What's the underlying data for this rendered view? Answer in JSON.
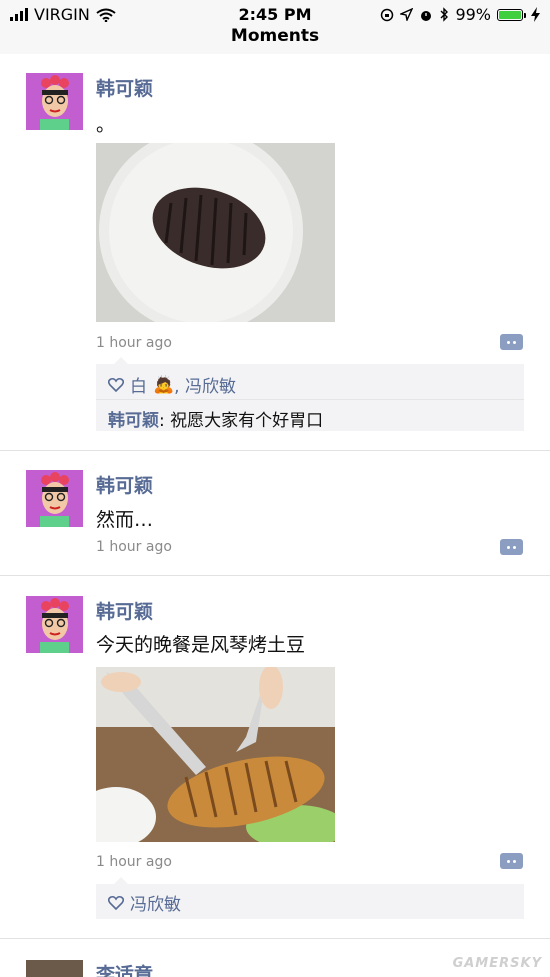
{
  "status_bar": {
    "carrier": "VIRGIN",
    "time": "2:45 PM",
    "battery_percent": "99%",
    "battery_level": 0.99
  },
  "header": {
    "title": "Moments"
  },
  "posts": [
    {
      "name": "韩可颖",
      "text": "。",
      "has_photo": true,
      "photo_desc_icon": "baked-potato-on-plate",
      "time": "1 hour ago",
      "likes_text": "白",
      "likes_emoji": "🙇",
      "likes_rest": ", 冯欣敏",
      "comment_author": "韩可颖",
      "comment_sep": ": ",
      "comment_text": "祝愿大家有个好胃口"
    },
    {
      "name": "韩可颖",
      "text": "然而…",
      "time": "1 hour ago"
    },
    {
      "name": "韩可颖",
      "text": "今天的晚餐是风琴烤土豆",
      "has_photo": true,
      "photo_desc_icon": "hasselback-potato-cutting",
      "time": "1 hour ago",
      "likes_text": "冯欣敏"
    },
    {
      "name": "李适章"
    }
  ],
  "watermark": "GAMERSKY",
  "colors": {
    "name_link": "#576b95",
    "avatar_bg": "#c35ed1",
    "interaction_bg": "#f3f3f5"
  }
}
